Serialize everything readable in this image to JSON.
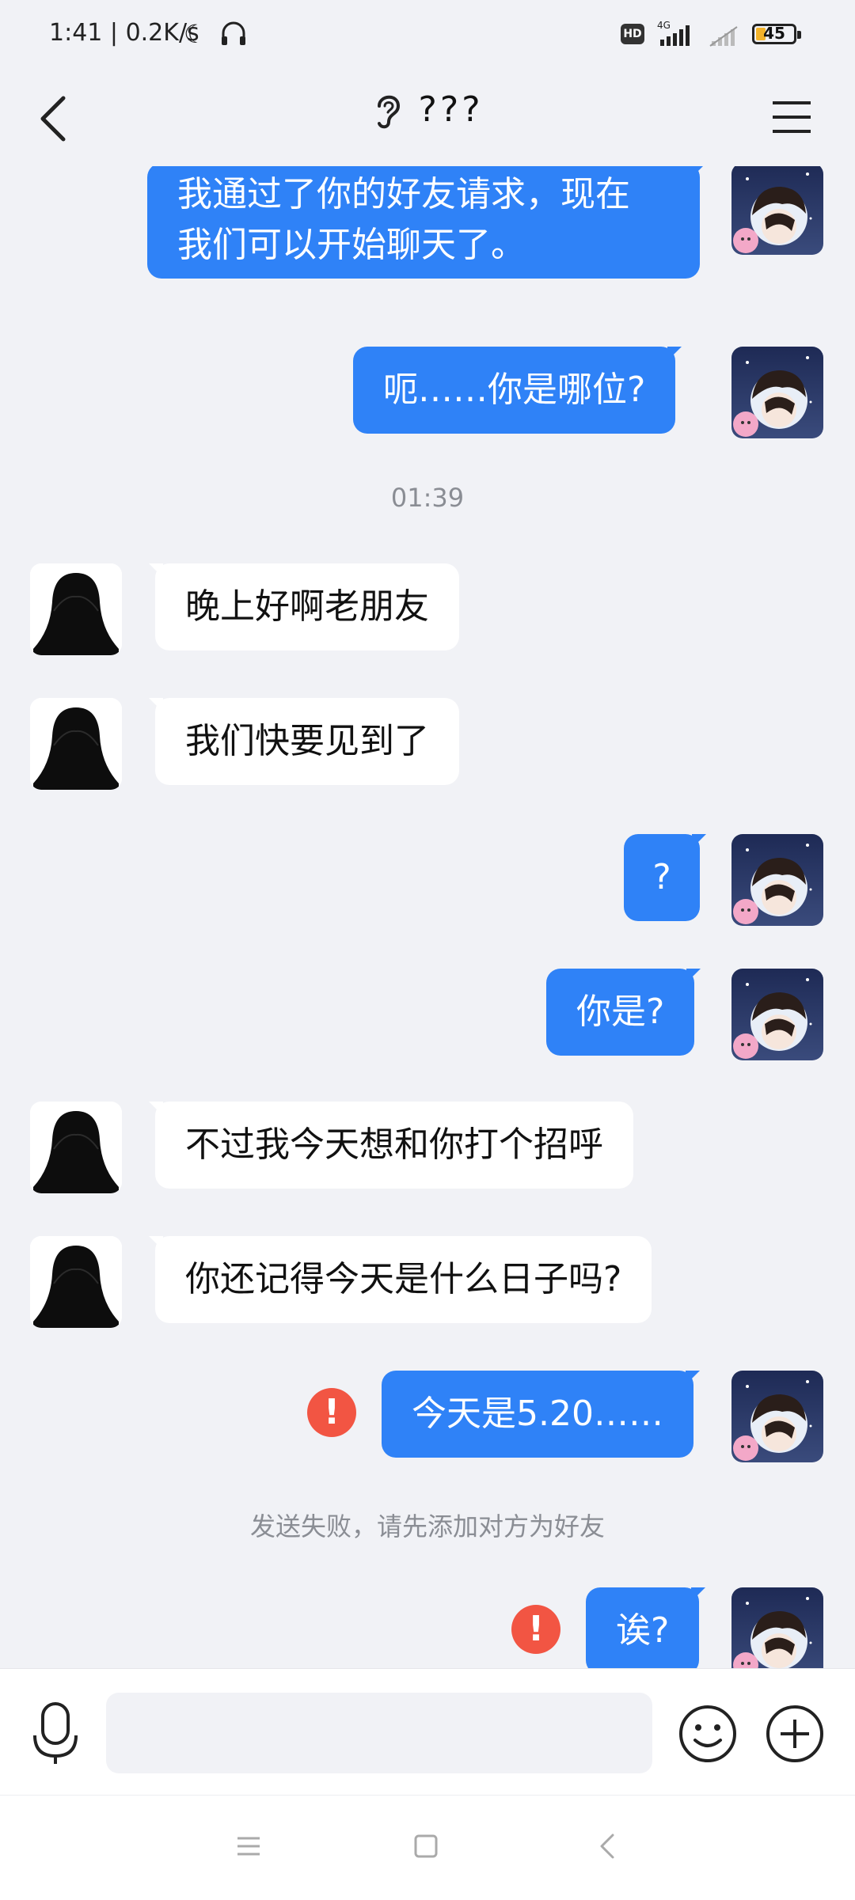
{
  "status_bar": {
    "time": "1:41",
    "speed": "0.2K/s",
    "hd": "HD",
    "network": "4G",
    "battery": "45",
    "icons": [
      "moon-icon",
      "headphones-icon",
      "signal-icon",
      "battery-icon"
    ]
  },
  "header": {
    "title": "???",
    "icons": [
      "back-arrow-icon",
      "ear-icon",
      "menu-icon"
    ]
  },
  "chat": {
    "timestamp": "01:39",
    "messages": [
      {
        "side": "me",
        "text1": "我通过了你的好友请求，现在",
        "text2": "我们可以开始聊天了。"
      },
      {
        "side": "me",
        "text": "呃……你是哪位?"
      },
      {
        "side": "them",
        "text": "晚上好啊老朋友"
      },
      {
        "side": "them",
        "text": "我们快要见到了"
      },
      {
        "side": "me",
        "text": "?"
      },
      {
        "side": "me",
        "text": "你是?"
      },
      {
        "side": "them",
        "text": "不过我今天想和你打个招呼"
      },
      {
        "side": "them",
        "text": "你还记得今天是什么日子吗?"
      },
      {
        "side": "me",
        "text": "今天是5.20……",
        "failed": true
      },
      {
        "side": "me",
        "text": "诶?",
        "failed": true
      }
    ],
    "failure_notice": "发送失败，请先添加对方为好友",
    "fail_mark": "!"
  },
  "input_bar": {
    "placeholder": "",
    "icons": [
      "microphone-icon",
      "emoji-icon",
      "plus-icon"
    ]
  },
  "colors": {
    "accent": "#2f82f7",
    "background": "#f1f2f6",
    "error": "#f25543"
  }
}
